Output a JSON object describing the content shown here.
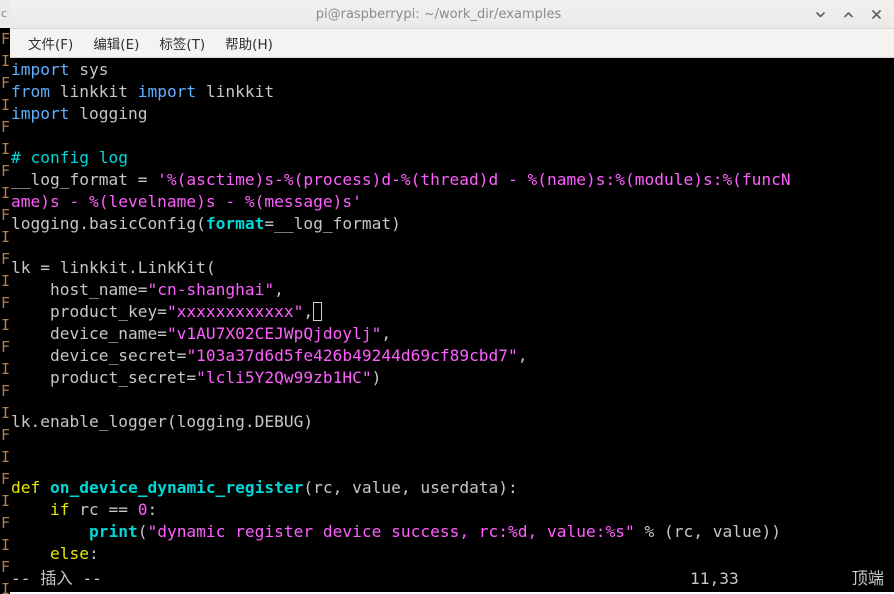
{
  "background_window": {
    "name": "occluded-terminal-behind",
    "title_fragment": "c",
    "edge_glyphs": "F\nI\nF\nI\nF\nI\nF\nI\nF\nI\nF\nI\nF\nI\nF\nI\nF\nI\nF\nI\nF\nI\nF\nI\nF\nI"
  },
  "titlebar": {
    "title": "pi@raspberrypi: ~/work_dir/examples",
    "controls": [
      {
        "name": "minimize-button",
        "glyph": "chevron-down-icon"
      },
      {
        "name": "maximize-button",
        "glyph": "chevron-up-icon"
      },
      {
        "name": "close-button",
        "glyph": "close-icon"
      }
    ]
  },
  "menubar": {
    "items": [
      {
        "label": "文件(F)"
      },
      {
        "label": "编辑(E)"
      },
      {
        "label": "标签(T)"
      },
      {
        "label": "帮助(H)"
      }
    ]
  },
  "editor": {
    "filetype": "python",
    "lines": [
      {
        "n": 1,
        "segments": [
          {
            "t": "import",
            "c": "tok-kw"
          },
          {
            "t": " sys",
            "c": "tok-ident"
          }
        ]
      },
      {
        "n": 2,
        "segments": [
          {
            "t": "from",
            "c": "tok-kw"
          },
          {
            "t": " linkkit ",
            "c": "tok-ident"
          },
          {
            "t": "import",
            "c": "tok-kw"
          },
          {
            "t": " linkkit",
            "c": "tok-ident"
          }
        ]
      },
      {
        "n": 3,
        "segments": [
          {
            "t": "import",
            "c": "tok-kw"
          },
          {
            "t": " logging",
            "c": "tok-ident"
          }
        ]
      },
      {
        "n": 4,
        "segments": [
          {
            "t": "",
            "c": "tok-ident"
          }
        ]
      },
      {
        "n": 5,
        "segments": [
          {
            "t": "# config log",
            "c": "tok-comment"
          }
        ]
      },
      {
        "n": 6,
        "segments": [
          {
            "t": "__log_format = ",
            "c": "tok-ident"
          },
          {
            "t": "'%(asctime)s-%(process)d-%(thread)d - %(name)s:%(module)s:%(funcN",
            "c": "tok-str"
          }
        ]
      },
      {
        "n": 6,
        "wrap": true,
        "segments": [
          {
            "t": "ame)s - %(levelname)s - %(message)s'",
            "c": "tok-str"
          }
        ]
      },
      {
        "n": 7,
        "segments": [
          {
            "t": "logging.basicConfig(",
            "c": "tok-ident"
          },
          {
            "t": "format",
            "c": "tok-builtin"
          },
          {
            "t": "=__log_format)",
            "c": "tok-ident"
          }
        ]
      },
      {
        "n": 8,
        "segments": [
          {
            "t": "",
            "c": "tok-ident"
          }
        ]
      },
      {
        "n": 9,
        "segments": [
          {
            "t": "lk = linkkit.LinkKit(",
            "c": "tok-ident"
          }
        ]
      },
      {
        "n": 10,
        "segments": [
          {
            "t": "    host_name=",
            "c": "tok-ident"
          },
          {
            "t": "\"cn-shanghai\"",
            "c": "tok-str"
          },
          {
            "t": ",",
            "c": "tok-ident"
          }
        ]
      },
      {
        "n": 11,
        "segments": [
          {
            "t": "    product_key=",
            "c": "tok-ident"
          },
          {
            "t": "\"xxxxxxxxxxxx\"",
            "c": "tok-str"
          },
          {
            "t": ",",
            "c": "tok-ident"
          }
        ],
        "cursor_at_end": true
      },
      {
        "n": 12,
        "segments": [
          {
            "t": "    device_name=",
            "c": "tok-ident"
          },
          {
            "t": "\"v1AU7X02CEJWpQjdoylj\"",
            "c": "tok-str"
          },
          {
            "t": ",",
            "c": "tok-ident"
          }
        ]
      },
      {
        "n": 13,
        "segments": [
          {
            "t": "    device_secret=",
            "c": "tok-ident"
          },
          {
            "t": "\"103a37d6d5fe426b49244d69cf89cbd7\"",
            "c": "tok-str"
          },
          {
            "t": ",",
            "c": "tok-ident"
          }
        ]
      },
      {
        "n": 14,
        "segments": [
          {
            "t": "    product_secret=",
            "c": "tok-ident"
          },
          {
            "t": "\"lcli5Y2Qw99zb1HC\"",
            "c": "tok-str"
          },
          {
            "t": ")",
            "c": "tok-ident"
          }
        ]
      },
      {
        "n": 15,
        "segments": [
          {
            "t": "",
            "c": "tok-ident"
          }
        ]
      },
      {
        "n": 16,
        "segments": [
          {
            "t": "lk.enable_logger(logging.DEBUG)",
            "c": "tok-ident"
          }
        ]
      },
      {
        "n": 17,
        "segments": [
          {
            "t": "",
            "c": "tok-ident"
          }
        ]
      },
      {
        "n": 18,
        "segments": [
          {
            "t": "",
            "c": "tok-ident"
          }
        ]
      },
      {
        "n": 19,
        "segments": [
          {
            "t": "def",
            "c": "tok-kw-y"
          },
          {
            "t": " ",
            "c": "tok-ident"
          },
          {
            "t": "on_device_dynamic_register",
            "c": "tok-func"
          },
          {
            "t": "(rc, value, userdata):",
            "c": "tok-ident"
          }
        ]
      },
      {
        "n": 20,
        "segments": [
          {
            "t": "    ",
            "c": "tok-ident"
          },
          {
            "t": "if",
            "c": "tok-kw-y"
          },
          {
            "t": " rc == ",
            "c": "tok-ident"
          },
          {
            "t": "0",
            "c": "tok-num"
          },
          {
            "t": ":",
            "c": "tok-ident"
          }
        ]
      },
      {
        "n": 21,
        "segments": [
          {
            "t": "        ",
            "c": "tok-ident"
          },
          {
            "t": "print",
            "c": "tok-builtin"
          },
          {
            "t": "(",
            "c": "tok-ident"
          },
          {
            "t": "\"dynamic register device success, rc:%d, value:%s\"",
            "c": "tok-str"
          },
          {
            "t": " % (rc, value))",
            "c": "tok-ident"
          }
        ]
      },
      {
        "n": 22,
        "segments": [
          {
            "t": "    ",
            "c": "tok-ident"
          },
          {
            "t": "else",
            "c": "tok-kw-y"
          },
          {
            "t": ":",
            "c": "tok-ident"
          }
        ]
      }
    ]
  },
  "statusline": {
    "mode": "-- 插入 --",
    "position": "11,33",
    "scroll": "顶端"
  }
}
